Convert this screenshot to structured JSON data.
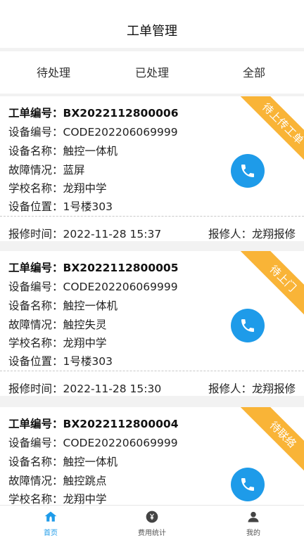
{
  "header": {
    "title": "工单管理"
  },
  "tabs": [
    {
      "label": "待处理"
    },
    {
      "label": "已处理"
    },
    {
      "label": "全部"
    }
  ],
  "selected_tab": "全部",
  "colors": {
    "accent": "#1e9be9",
    "ribbon": "#f9b437",
    "underline": "#1f2a44"
  },
  "labels": {
    "order_no": "工单编号：",
    "device_no": "设备编号：",
    "device_name": "设备名称：",
    "fault": "故障情况：",
    "school": "学校名称：",
    "location": "设备位置：",
    "report_time": "报修时间：",
    "reporter": "报修人："
  },
  "cards": [
    {
      "order_no": "BX2022112800006",
      "device_no": "CODE202206069999",
      "device_name": "触控一体机",
      "fault": "蓝屏",
      "school": "龙翔中学",
      "location": "1号楼303",
      "report_time": "2022-11-28 15:37",
      "reporter": "龙翔报修",
      "status": "待上传工单",
      "call_icon": "phone-icon"
    },
    {
      "order_no": "BX2022112800005",
      "device_no": "CODE202206069999",
      "device_name": "触控一体机",
      "fault": "触控失灵",
      "school": "龙翔中学",
      "location": "1号楼303",
      "report_time": "2022-11-28 15:30",
      "reporter": "龙翔报修",
      "status": "待上门",
      "call_icon": "phone-icon"
    },
    {
      "order_no": "BX2022112800004",
      "device_no": "CODE202206069999",
      "device_name": "触控一体机",
      "fault": "触控跳点",
      "school": "龙翔中学",
      "status": "待联络",
      "call_icon": "phone-icon"
    }
  ],
  "navbar": [
    {
      "label": "首页",
      "icon": "home-icon",
      "active": true
    },
    {
      "label": "费用统计",
      "icon": "yen-coin-icon",
      "active": false
    },
    {
      "label": "我的",
      "icon": "user-icon",
      "active": false
    }
  ]
}
